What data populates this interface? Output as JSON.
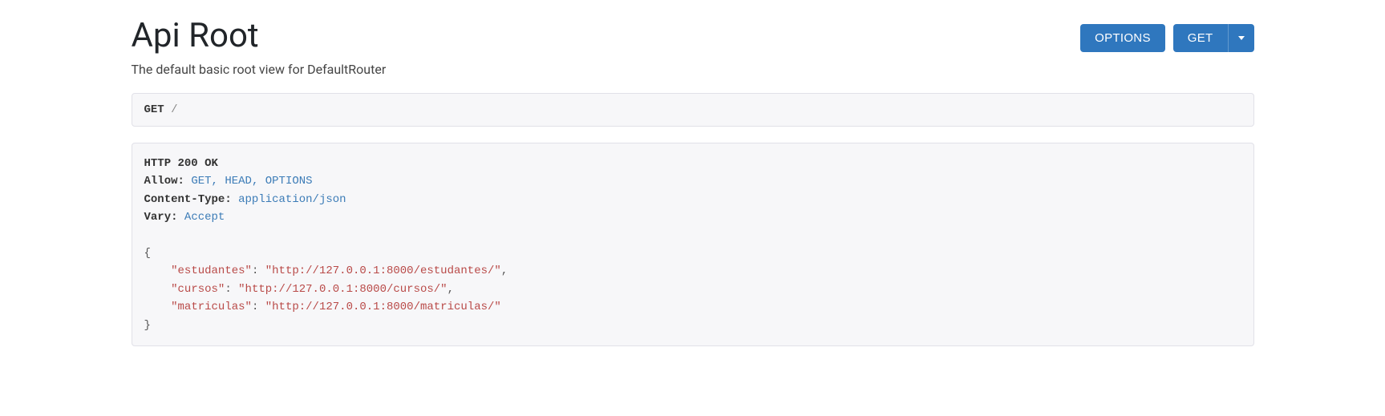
{
  "page": {
    "title": "Api Root",
    "description": "The default basic root view for DefaultRouter"
  },
  "buttons": {
    "options_label": "OPTIONS",
    "get_label": "GET"
  },
  "request": {
    "method": "GET",
    "path": "/"
  },
  "response": {
    "status_line": "HTTP 200 OK",
    "headers": [
      {
        "name": "Allow:",
        "value": "GET, HEAD, OPTIONS"
      },
      {
        "name": "Content-Type:",
        "value": "application/json"
      },
      {
        "name": "Vary:",
        "value": "Accept"
      }
    ],
    "body": {
      "estudantes": "http://127.0.0.1:8000/estudantes/",
      "cursos": "http://127.0.0.1:8000/cursos/",
      "matriculas": "http://127.0.0.1:8000/matriculas/"
    }
  }
}
